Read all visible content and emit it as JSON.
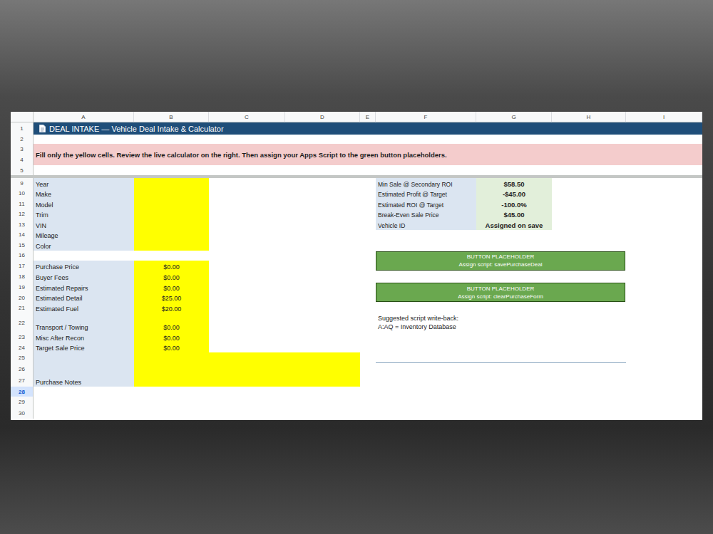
{
  "sheet": {
    "columns": [
      {
        "label": "A"
      },
      {
        "label": "B"
      },
      {
        "label": "C"
      },
      {
        "label": "D"
      },
      {
        "label": "E"
      },
      {
        "label": "F"
      },
      {
        "label": "G"
      },
      {
        "label": "H"
      },
      {
        "label": "I"
      }
    ],
    "rows": [
      {
        "number": "1",
        "selected": false
      },
      {
        "number": "2",
        "selected": false
      },
      {
        "number": "3",
        "selected": false
      },
      {
        "number": "4",
        "selected": false
      },
      {
        "number": "5",
        "selected": false
      },
      {
        "number": "9",
        "selected": false
      },
      {
        "number": "10",
        "selected": false
      },
      {
        "number": "11",
        "selected": false
      },
      {
        "number": "12",
        "selected": false
      },
      {
        "number": "13",
        "selected": false
      },
      {
        "number": "14",
        "selected": false
      },
      {
        "number": "15",
        "selected": false
      },
      {
        "number": "16",
        "selected": false
      },
      {
        "number": "17",
        "selected": false
      },
      {
        "number": "18",
        "selected": false
      },
      {
        "number": "19",
        "selected": false
      },
      {
        "number": "20",
        "selected": false
      },
      {
        "number": "21",
        "selected": false
      },
      {
        "number": "22",
        "selected": false
      },
      {
        "number": "23",
        "selected": false
      },
      {
        "number": "24",
        "selected": false
      },
      {
        "number": "25",
        "selected": false
      },
      {
        "number": "26",
        "selected": false
      },
      {
        "number": "27",
        "selected": false
      },
      {
        "number": "28",
        "selected": true
      },
      {
        "number": "29",
        "selected": false
      },
      {
        "number": "30",
        "selected": false
      }
    ]
  },
  "title": "DEAL INTAKE — Vehicle Deal Intake & Calculator",
  "instructions": "Fill only the yellow cells. Review the live calculator on the right. Then assign your Apps Script to the green button placeholders.",
  "vehicle_fields": [
    {
      "label": "Year",
      "value": ""
    },
    {
      "label": "Make",
      "value": ""
    },
    {
      "label": "Model",
      "value": ""
    },
    {
      "label": "Trim",
      "value": ""
    },
    {
      "label": "VIN",
      "value": ""
    },
    {
      "label": "Mileage",
      "value": ""
    },
    {
      "label": "Color",
      "value": ""
    }
  ],
  "cost_fields": [
    {
      "label": "Purchase Price",
      "value": "$0.00"
    },
    {
      "label": "Buyer Fees",
      "value": "$0.00"
    },
    {
      "label": "Estimated Repairs",
      "value": "$0.00"
    },
    {
      "label": "Estimated Detail",
      "value": "$25.00"
    },
    {
      "label": "Estimated Fuel",
      "value": "$20.00"
    },
    {
      "label": "Transport / Towing",
      "value": "$0.00"
    },
    {
      "label": "Misc After Recon",
      "value": "$0.00"
    },
    {
      "label": "Target Sale Price",
      "value": "$0.00"
    }
  ],
  "notes": {
    "label": "Purchase Notes",
    "value": ""
  },
  "calculator": [
    {
      "label": "Min Sale @ Secondary ROI",
      "value": "$58.50"
    },
    {
      "label": "Estimated Profit @ Target",
      "value": "-$45.00"
    },
    {
      "label": "Estimated ROI @ Target",
      "value": "-100.0%"
    },
    {
      "label": "Break-Even Sale Price",
      "value": "$45.00"
    },
    {
      "label": "Vehicle ID",
      "value": "Assigned on save"
    }
  ],
  "buttons": [
    {
      "title": "BUTTON PLACEHOLDER",
      "subtitle": "Assign script: savePurchaseDeal"
    },
    {
      "title": "BUTTON PLACEHOLDER",
      "subtitle": "Assign script: clearPurchaseForm"
    }
  ],
  "write_back": [
    "Suggested script write-back:",
    "A:AQ = Inventory Database"
  ]
}
